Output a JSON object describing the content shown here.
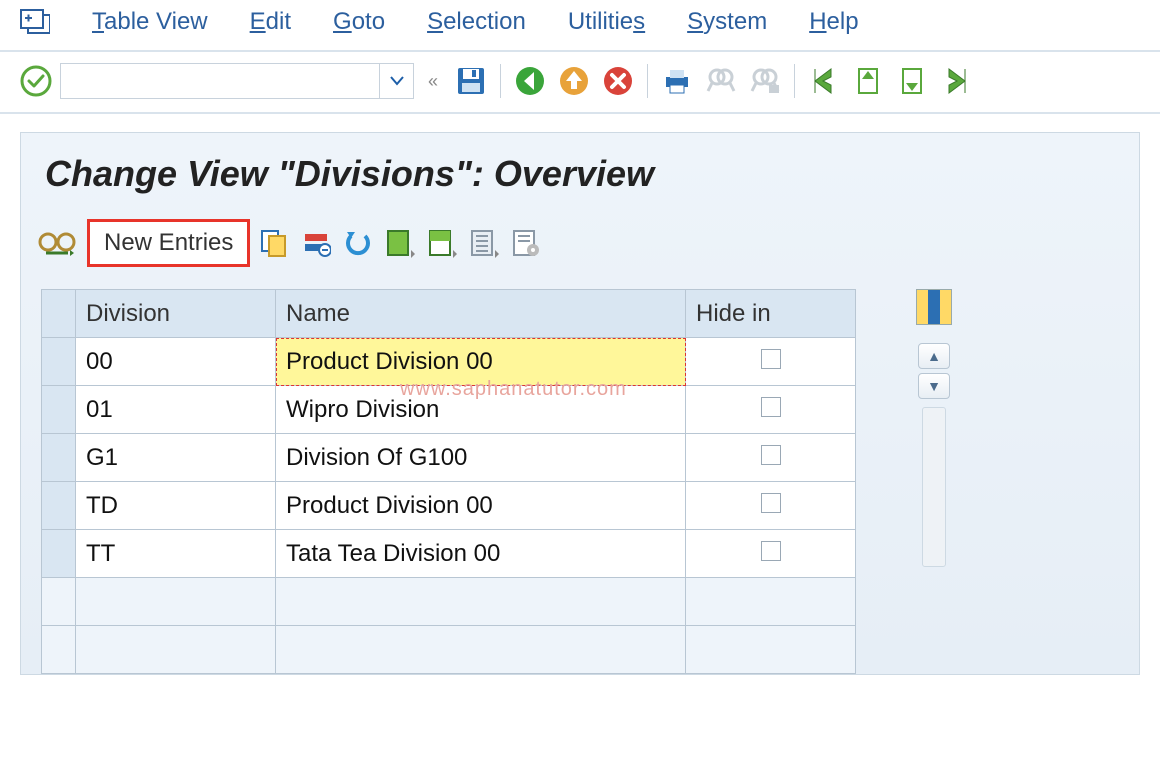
{
  "menu": {
    "table_view": "Table View",
    "edit": "Edit",
    "goto": "Goto",
    "selection": "Selection",
    "utilities_pre": "Utilitie",
    "utilities_un": "s",
    "system": "System",
    "help": "Help"
  },
  "toolbar": {
    "command_value": ""
  },
  "page": {
    "title": "Change View \"Divisions\": Overview",
    "new_entries": "New Entries"
  },
  "table": {
    "headers": {
      "division": "Division",
      "name": "Name",
      "hide": "Hide in"
    },
    "rows": [
      {
        "division": "00",
        "name": "Product Division 00",
        "hide": false,
        "highlight": true
      },
      {
        "division": "01",
        "name": "Wipro Division",
        "hide": false,
        "highlight": false
      },
      {
        "division": "G1",
        "name": "Division Of G100",
        "hide": false,
        "highlight": false
      },
      {
        "division": "TD",
        "name": "Product Division 00",
        "hide": false,
        "highlight": false
      },
      {
        "division": "TT",
        "name": "Tata Tea Division 00",
        "hide": false,
        "highlight": false
      }
    ],
    "empty_rows": 2
  },
  "watermark": "www.saphanatutor.com"
}
